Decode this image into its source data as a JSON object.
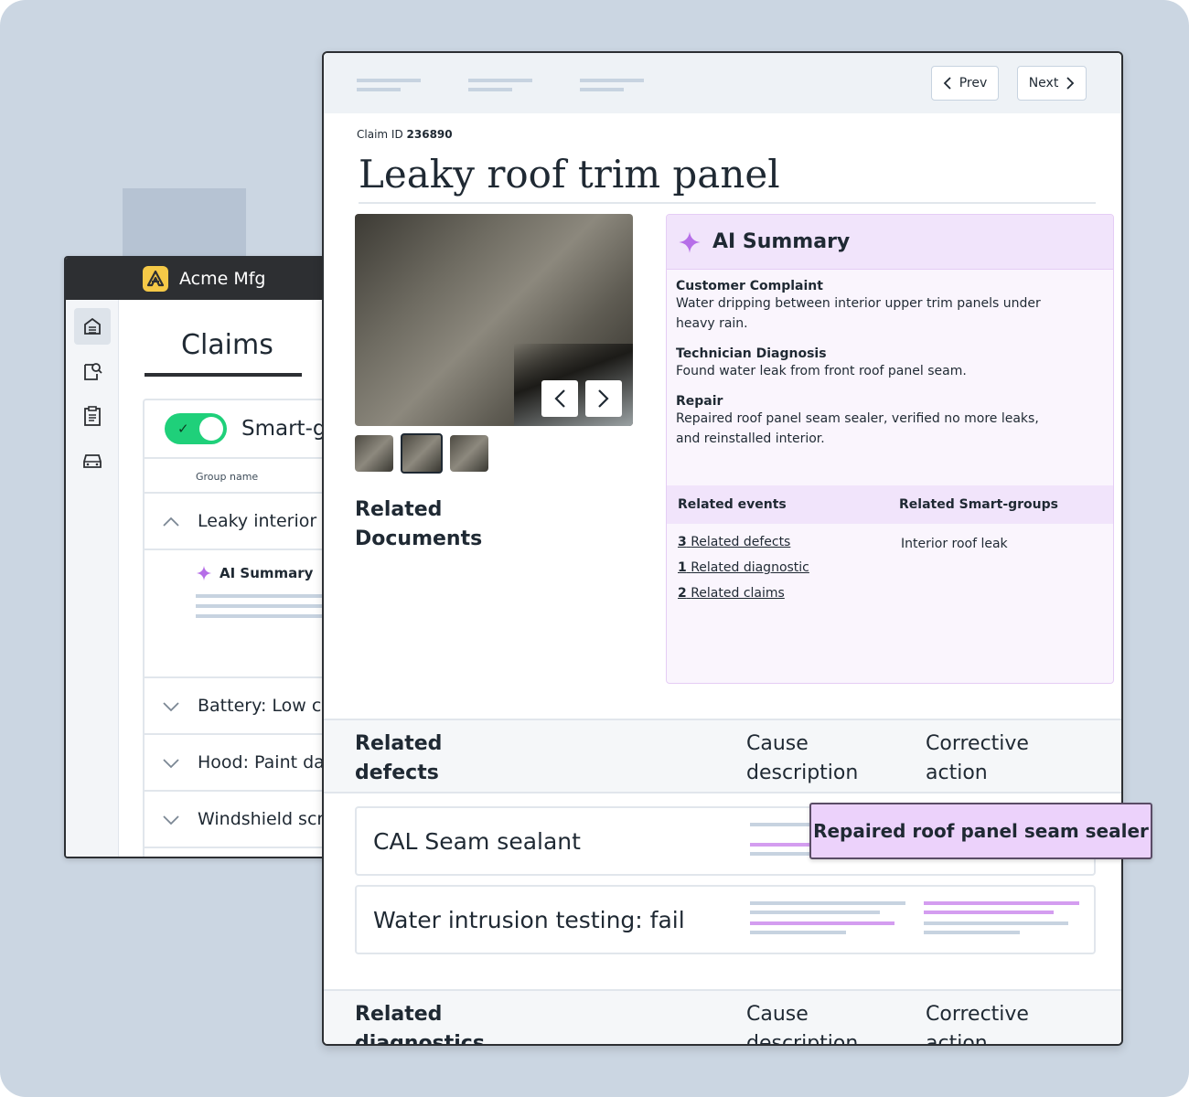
{
  "app": {
    "name": "Acme Mfg"
  },
  "back": {
    "claims_title": "Claims",
    "smart_groups_label": "Smart-g",
    "column_header": "Group name",
    "groups": [
      {
        "label": "Leaky interior",
        "expanded": true
      },
      {
        "label": "Battery: Low ch",
        "expanded": false
      },
      {
        "label": "Hood: Paint dar",
        "expanded": false
      },
      {
        "label": "Windshield scra",
        "expanded": false
      }
    ],
    "ai_summary_label": "AI Summary"
  },
  "nav": {
    "prev": "Prev",
    "next": "Next"
  },
  "claim": {
    "id_label": "Claim ID",
    "id_value": "236890",
    "title": "Leaky roof trim panel"
  },
  "related_documents": "Related Documents",
  "ai_summary": {
    "title": "AI Summary",
    "sections": [
      {
        "heading": "Customer Complaint",
        "text": "Water dripping between interior upper trim panels under heavy rain."
      },
      {
        "heading": "Technician Diagnosis",
        "text": "Found water leak from front roof panel seam."
      },
      {
        "heading": "Repair",
        "text": "Repaired roof panel seam sealer, verified no more leaks, and reinstalled interior."
      }
    ],
    "related_events_header": "Related events",
    "related_smart_groups_header": "Related Smart-groups",
    "events": [
      {
        "count": "3",
        "label": "Related defects"
      },
      {
        "count": "1",
        "label": "Related diagnostic"
      },
      {
        "count": "2",
        "label": "Related claims"
      }
    ],
    "smart_groups": [
      "Interior roof leak"
    ]
  },
  "defects_section": {
    "title": "Related defects",
    "cause_header": "Cause description",
    "action_header": "Corrective action",
    "rows": [
      "CAL Seam sealant",
      "Water intrusion testing: fail"
    ]
  },
  "diagnostics_section": {
    "title": "Related diagnostics",
    "cause_header": "Cause description",
    "action_header": "Corrective action"
  },
  "tooltip": "Repaired roof panel seam sealer",
  "colors": {
    "accent": "#1fd07a",
    "ai_purple": "#b66ee8",
    "logo": "#f5c947"
  }
}
